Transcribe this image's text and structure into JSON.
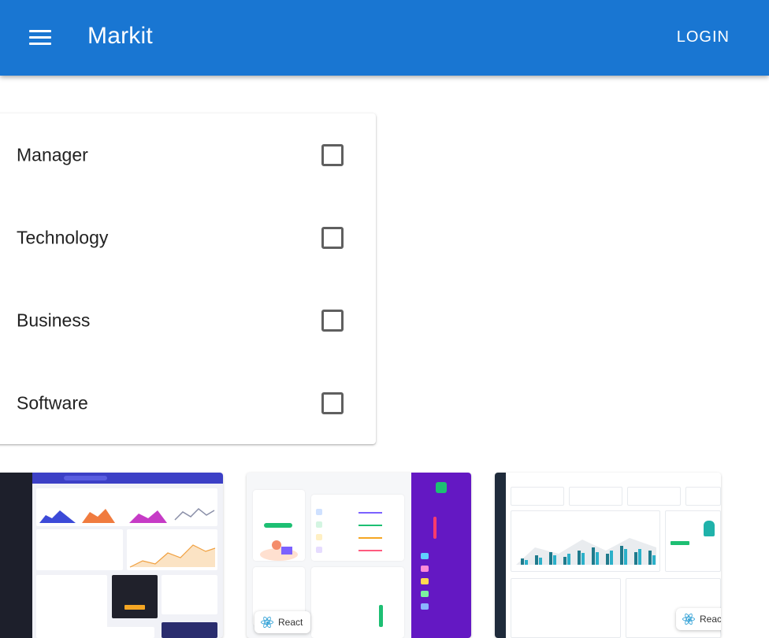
{
  "app": {
    "title": "Markit",
    "login_label": "LOGIN",
    "accent": "#1976d2"
  },
  "filters": [
    {
      "label": "Manager",
      "checked": false
    },
    {
      "label": "Technology",
      "checked": false
    },
    {
      "label": "Business",
      "checked": false
    },
    {
      "label": "Software",
      "checked": false
    }
  ],
  "thumbnails": [
    {
      "name": "crypto-dashboard-template"
    },
    {
      "name": "start-mobile-app-template",
      "badge": "React"
    },
    {
      "name": "analytics-dashboard-template",
      "badge": "Reac"
    }
  ]
}
